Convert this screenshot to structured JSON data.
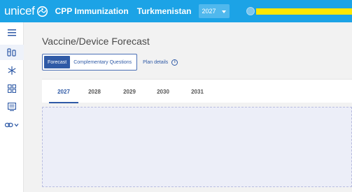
{
  "header": {
    "logo_text": "unicef",
    "app_title": "CPP Immunization",
    "country": "Turkmenistan",
    "year_select": {
      "value": "2027"
    }
  },
  "sidebar": {
    "items": [
      {
        "icon": "menu-icon"
      },
      {
        "icon": "vaccine-icon"
      },
      {
        "icon": "snowflake-icon"
      },
      {
        "icon": "grid-icon"
      },
      {
        "icon": "document-icon"
      },
      {
        "icon": "link-dropdown-icon"
      }
    ]
  },
  "main": {
    "page_title": "Vaccine/Device Forecast",
    "subtabs": [
      {
        "label": "Forecast",
        "active": true
      },
      {
        "label": "Complementary Questions",
        "active": false
      }
    ],
    "plan_details_label": "Plan details",
    "info_icon_glyph": "i",
    "year_tabs": [
      {
        "label": "2027",
        "active": true
      },
      {
        "label": "2028",
        "active": false
      },
      {
        "label": "2029",
        "active": false
      },
      {
        "label": "2030",
        "active": false
      },
      {
        "label": "2031",
        "active": false
      }
    ]
  },
  "colors": {
    "topbar": "#1ca3e6",
    "accent": "#2f5aa6",
    "highlight_bar": "#ffe600"
  }
}
